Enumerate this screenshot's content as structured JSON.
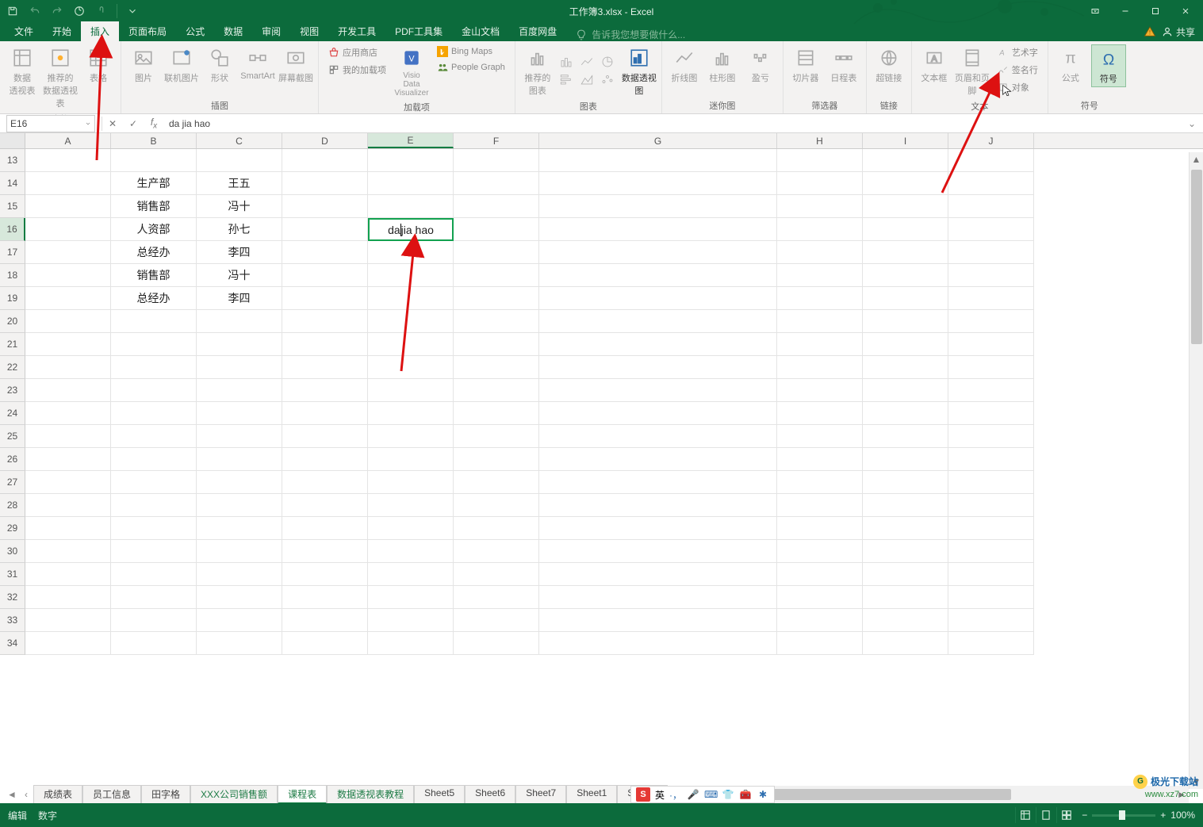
{
  "app": {
    "title": "工作簿3.xlsx - Excel"
  },
  "menu": {
    "tabs": [
      "文件",
      "开始",
      "插入",
      "页面布局",
      "公式",
      "数据",
      "审阅",
      "视图",
      "开发工具",
      "PDF工具集",
      "金山文档",
      "百度网盘"
    ],
    "activeIndex": 2,
    "tellMe": "告诉我您想要做什么...",
    "share": "共享"
  },
  "ribbon": {
    "groups": {
      "tables": {
        "label": "表格",
        "btns": {
          "pivot": "数据\n透视表",
          "recommended": "推荐的\n数据透视表",
          "table": "表格"
        }
      },
      "illustrations": {
        "label": "插图",
        "btns": {
          "pictures": "图片",
          "online": "联机图片",
          "shapes": "形状",
          "smartart": "SmartArt",
          "screenshot": "屏幕截图"
        }
      },
      "addins": {
        "label": "加载项",
        "store": "应用商店",
        "myaddins": "我的加载项",
        "visio": "Visio Data\nVisualizer",
        "bing": "Bing Maps",
        "people": "People Graph"
      },
      "charts": {
        "label": "图表",
        "recommended": "推荐的\n图表",
        "pivotchart": "数据透视图"
      },
      "sparklines": {
        "label": "迷你图",
        "line": "折线图",
        "column": "柱形图",
        "winloss": "盈亏"
      },
      "filters": {
        "label": "筛选器",
        "slicer": "切片器",
        "timeline": "日程表"
      },
      "links": {
        "label": "链接",
        "hyperlink": "超链接"
      },
      "text": {
        "label": "文本",
        "textbox": "文本框",
        "headerfooter": "页眉和页脚",
        "wordart": "艺术字",
        "sigline": "签名行",
        "object": "对象"
      },
      "symbols": {
        "label": "符号",
        "equation": "公式",
        "symbol": "符号"
      }
    }
  },
  "formulaBar": {
    "name": "E16",
    "formula": "da jia hao"
  },
  "columns": [
    "A",
    "B",
    "C",
    "D",
    "E",
    "F",
    "G",
    "H",
    "I",
    "J"
  ],
  "rowStart": 13,
  "rowEnd": 34,
  "selectedRow": 16,
  "selectedCol": "E",
  "cells": {
    "B14": "生产部",
    "C14": "王五",
    "B15": "销售部",
    "C15": "冯十",
    "B16": "人资部",
    "C16": "孙七",
    "B17": "总经办",
    "C17": "李四",
    "B18": "销售部",
    "C18": "冯十",
    "B19": "总经办",
    "C19": "李四"
  },
  "editingCell": {
    "ref": "E16",
    "before": "da",
    "after": " jia hao"
  },
  "sheets": {
    "tabs": [
      "成绩表",
      "员工信息",
      "田字格",
      "XXX公司销售额",
      "课程表",
      "数据透视表教程",
      "Sheet5",
      "Sheet6",
      "Sheet7",
      "Sheet1",
      "Sheet2"
    ],
    "activeIndex": 4,
    "greenIndexes": [
      3,
      4,
      5
    ]
  },
  "status": {
    "mode": "编辑",
    "num": "数字"
  },
  "ime": {
    "lang": "英"
  },
  "zoom": {
    "pct": "100%"
  },
  "watermark": {
    "line1": "极光下载站",
    "line2": "www.xz7.com"
  }
}
